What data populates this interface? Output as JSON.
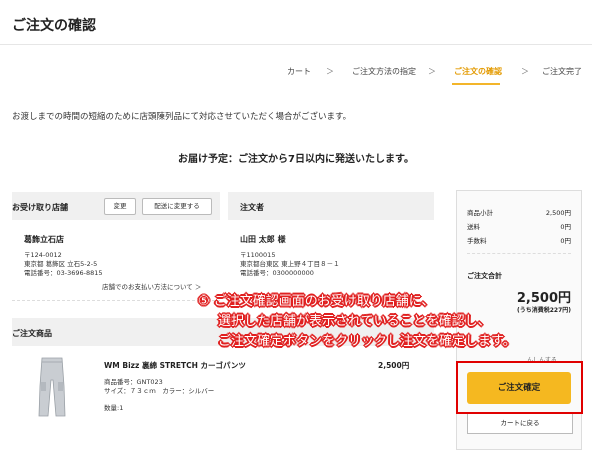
{
  "page_title": "ご注文の確認",
  "steps": [
    {
      "label": "カート",
      "active": false
    },
    {
      "label": "ご注文方法の指定",
      "active": false
    },
    {
      "label": "ご注文の確認",
      "active": true
    },
    {
      "label": "ご注文完了",
      "active": false
    }
  ],
  "step_separator": "＞",
  "notice": "お渡しまでの時間の短縮のために店頭陳列品にて対応させていただく場合がございます。",
  "delivery": "お届け予定：ご注文から7日以内に発送いたします。",
  "pickup_store": {
    "heading": "お受け取り店舗",
    "change_label": "変更",
    "switch_delivery_label": "配送に変更する",
    "store_name": "葛飾立石店",
    "postal": "〒124-0012",
    "address": "東京都 葛飾区 立石5-2-5",
    "phone": "電話番号：03-3696-8815",
    "payment_link": "店舗でのお支払い方法について ＞"
  },
  "orderer": {
    "heading": "注文者",
    "name": "山田 太郎 様",
    "postal": "〒1100015",
    "address": "東京都台東区 東上野４丁目８－１",
    "phone": "電話番号：0300000000"
  },
  "products": {
    "heading": "ご注文商品",
    "items": [
      {
        "name": "WM Bizz 裏綿 STRETCH カーゴパンツ",
        "price": "2,500円",
        "code": "商品番号：GNT023",
        "variant": "サイズ：７３ｃｍ　カラー：シルバー",
        "qty": "数量:1"
      }
    ]
  },
  "summary": {
    "rows": [
      {
        "label": "商品小計",
        "value": "2,500円"
      },
      {
        "label": "送料",
        "value": "0円"
      },
      {
        "label": "手数料",
        "value": "0円"
      }
    ],
    "total_label": "ご注文合計",
    "total_value": "2,500円",
    "tax_note": "(うち消費税227円)",
    "partial_text": "んしんする",
    "confirm_label": "ご注文確定",
    "back_label": "カートに戻る"
  },
  "annotation": [
    "⑤ ご注文確認画面のお受け取り店舗に、",
    "選択した店舗が表示されていることを確認し、",
    "ご注文確定ボタンをクリックし注文を確定します。"
  ],
  "colors": {
    "accent": "#f5b820",
    "highlight": "#e00000",
    "step_active": "#e39a00"
  }
}
